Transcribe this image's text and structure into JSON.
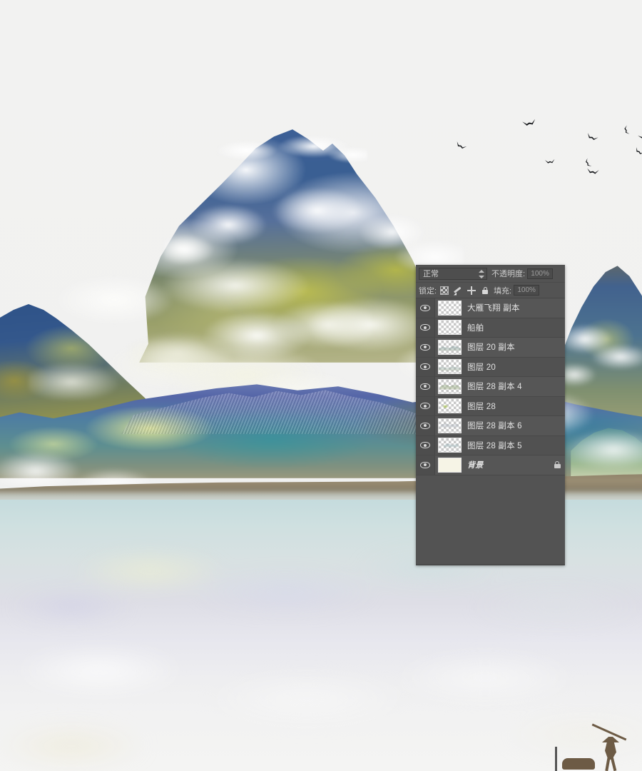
{
  "artwork": {
    "title": "Chinese ink-style digital landscape",
    "elements": {
      "birds_label": "flying geese silhouettes",
      "fisherman_label": "fisherman with pole",
      "water_label": "misty lake reflection",
      "mountains_label": "layered mountain ranges"
    },
    "palette": {
      "paper": "#f0f0f0",
      "mountain_blue": "#3d5f96",
      "mountain_yellow": "#d8d23c",
      "ridge_violet": "#6f7fb5",
      "teal": "#2f96a0",
      "shore_brown": "#8d8068",
      "water_pale": "#dfe6e8"
    }
  },
  "layers_panel": {
    "blend_mode": "正常",
    "opacity_label": "不透明度:",
    "opacity_value": "100%",
    "lock_label": "锁定:",
    "fill_label": "填充:",
    "fill_value": "100%",
    "lock_icons": [
      "lock-transparent-pixels-icon",
      "lock-image-pixels-icon",
      "lock-position-icon",
      "lock-all-icon"
    ],
    "layers": [
      {
        "name": "大雁飞翔 副本",
        "visible": true,
        "thumb": "transparent",
        "locked": false
      },
      {
        "name": "船舶",
        "visible": true,
        "thumb": "transparent",
        "locked": false
      },
      {
        "name": "图层 20 副本",
        "visible": true,
        "thumb": "transparent",
        "locked": false
      },
      {
        "name": "图层 20",
        "visible": true,
        "thumb": "transparent",
        "locked": false
      },
      {
        "name": "图层 28 副本 4",
        "visible": true,
        "thumb": "transparent",
        "locked": false
      },
      {
        "name": "图层 28",
        "visible": true,
        "thumb": "transparent",
        "locked": false
      },
      {
        "name": "图层 28 副本 6",
        "visible": true,
        "thumb": "transparent",
        "locked": false
      },
      {
        "name": "图层 28 副本 5",
        "visible": true,
        "thumb": "transparent",
        "locked": false
      },
      {
        "name": "背景",
        "visible": true,
        "thumb": "solid",
        "locked": true
      }
    ]
  }
}
